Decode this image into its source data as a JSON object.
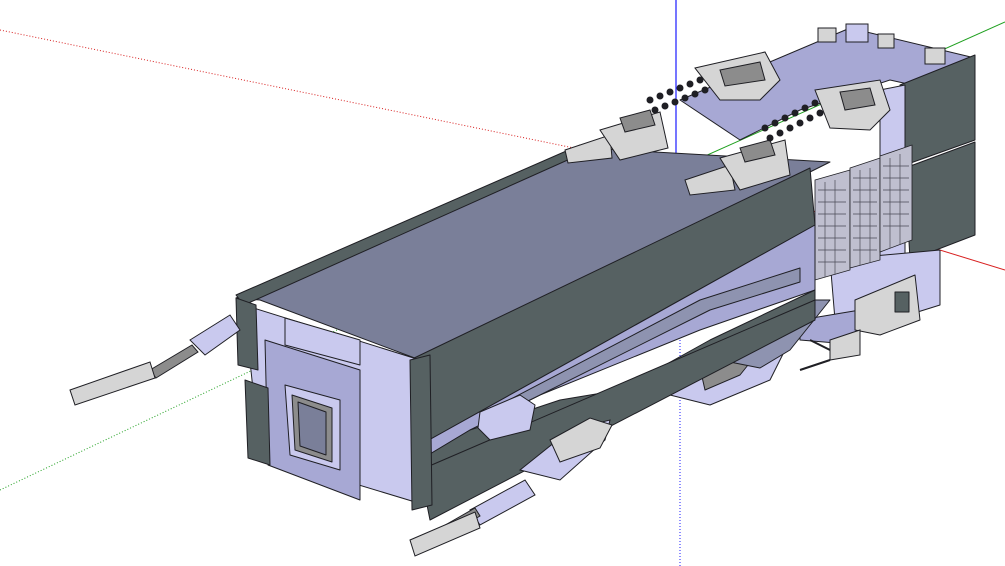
{
  "app": {
    "viewport_background": "#ffffff"
  },
  "scene": {
    "object_name": "spaceship-model",
    "axes": {
      "red": "#d82020",
      "green": "#1fa01f",
      "blue": "#1a1aff"
    },
    "colors": {
      "hull_top": "#7a7f99",
      "hull_light": "#c9c9ee",
      "hull_mid": "#a7a8d4",
      "side_panel": "#566162",
      "side_panel_dark": "#45504f",
      "edge": "#1f1f24",
      "turret": "#d5d5d5",
      "turret_dark": "#8c8c8c"
    }
  }
}
